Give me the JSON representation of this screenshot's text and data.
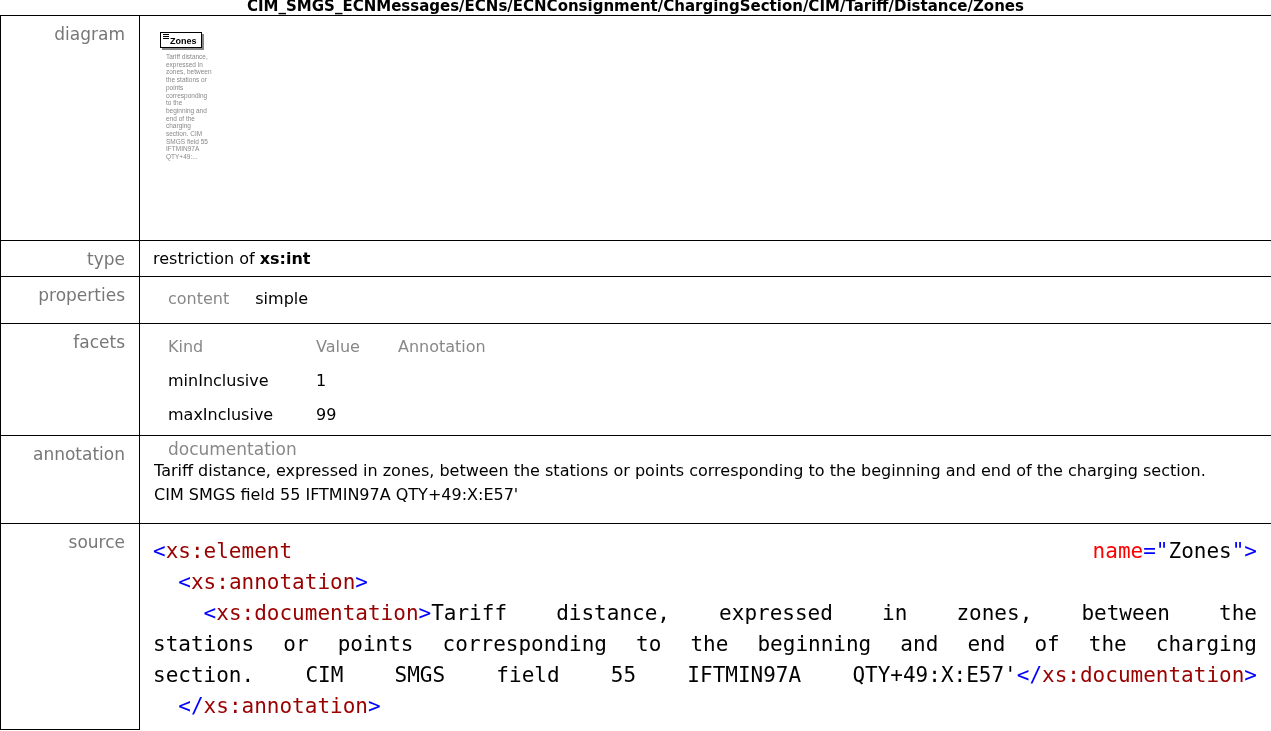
{
  "heading": "CIM_SMGS_ECNMessages/ECNs/ECNConsignment/ChargingSection/CIM/Tariff/Distance/Zones",
  "diagram": {
    "label": "diagram",
    "element": "Zones",
    "documentation": "Tariff distance, expressed in zones, between the stations or points corresponding to the beginning and end of the charging section. CIM SMGS field 55 IFTMIN97A QTY+49:..."
  },
  "type": {
    "label": "type",
    "prefix": "restriction of",
    "base": "xs:int"
  },
  "properties": {
    "label": "properties",
    "items": [
      {
        "name": "content",
        "value": "simple"
      }
    ]
  },
  "facets": {
    "label": "facets",
    "columns": [
      "Kind",
      "Value",
      "Annotation"
    ],
    "rows": [
      {
        "kind": "minInclusive",
        "value": "1"
      },
      {
        "kind": "maxInclusive",
        "value": "99"
      }
    ]
  },
  "annotation": {
    "label": "annotation",
    "heading": "documentation",
    "text": "Tariff distance, expressed in zones, between the stations or points corresponding to the beginning and end of the charging section.  CIM SMGS field 55 IFTMIN97A QTY+49:X:E57'"
  },
  "source": {
    "label": "source",
    "lines": [
      [
        {
          "kind": "punct",
          "text": "<"
        },
        {
          "kind": "tag",
          "text": "xs:element "
        },
        {
          "kind": "attr",
          "text": "name"
        },
        {
          "kind": "punct",
          "text": "=\""
        },
        {
          "kind": "text",
          "text": "Zones"
        },
        {
          "kind": "punct",
          "text": "\">"
        }
      ],
      [
        {
          "kind": "punct",
          "text": "  <"
        },
        {
          "kind": "tag",
          "text": "xs:annotation"
        },
        {
          "kind": "punct",
          "text": ">"
        }
      ],
      [
        {
          "kind": "punct",
          "text": "    <"
        },
        {
          "kind": "tag",
          "text": "xs:documentation"
        },
        {
          "kind": "punct",
          "text": ">"
        },
        {
          "kind": "text",
          "text": "Tariff distance, expressed in zones, between the"
        }
      ],
      [
        {
          "kind": "text",
          "text": "stations or points corresponding to the beginning and end of the charging"
        }
      ],
      [
        {
          "kind": "text",
          "text": "section.   CIM SMGS field 55 IFTMIN97A QTY+49:X:E57'"
        },
        {
          "kind": "punct",
          "text": "</"
        },
        {
          "kind": "tag",
          "text": "xs:documentation"
        },
        {
          "kind": "punct",
          "text": ">"
        }
      ],
      [
        {
          "kind": "punct",
          "text": "  </"
        },
        {
          "kind": "tag",
          "text": "xs:annotation"
        },
        {
          "kind": "punct",
          "text": ">"
        }
      ]
    ]
  }
}
